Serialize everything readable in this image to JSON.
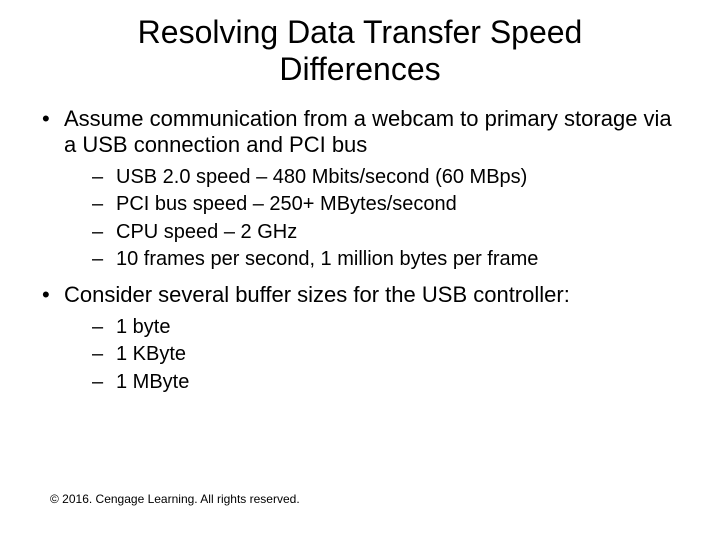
{
  "title_line1": "Resolving Data Transfer Speed",
  "title_line2": "Differences",
  "bullets": [
    {
      "text": "Assume communication from a webcam to primary storage via a USB connection and PCI bus",
      "sub": [
        "USB 2.0 speed – 480 Mbits/second (60 MBps)",
        "PCI bus speed – 250+ MBytes/second",
        "CPU speed – 2 GHz",
        "10 frames per second, 1 million bytes per frame"
      ]
    },
    {
      "text": "Consider several buffer sizes for the USB controller:",
      "sub": [
        "1 byte",
        "1 KByte",
        "1 MByte"
      ]
    }
  ],
  "footer": "© 2016. Cengage Learning. All rights reserved."
}
